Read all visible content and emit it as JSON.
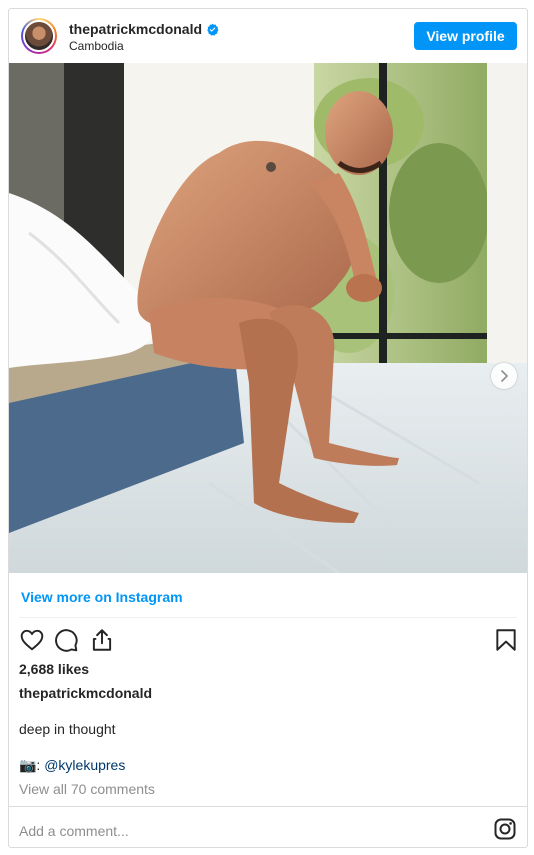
{
  "post": {
    "username": "thepatrickmcdonald",
    "location": "Cambodia",
    "view_profile_label": "View profile",
    "view_more_label": "View more on Instagram",
    "likes": "2,688 likes",
    "caption_user": "thepatrickmcdonald",
    "caption": "deep in thought",
    "credit_prefix": "📷: ",
    "credit_mention": "@kylekupres",
    "comments_link": "View all 70 comments",
    "add_comment_placeholder": "Add a comment..."
  },
  "icons": {
    "verified": "verified-badge-icon",
    "like": "heart-icon",
    "comment": "comment-icon",
    "share": "share-icon",
    "save": "bookmark-icon",
    "next": "chevron-right-icon",
    "brand": "instagram-icon"
  },
  "colors": {
    "accent": "#0095f6",
    "text": "#262626",
    "muted": "#8e8e8e",
    "mention": "#00376b"
  }
}
